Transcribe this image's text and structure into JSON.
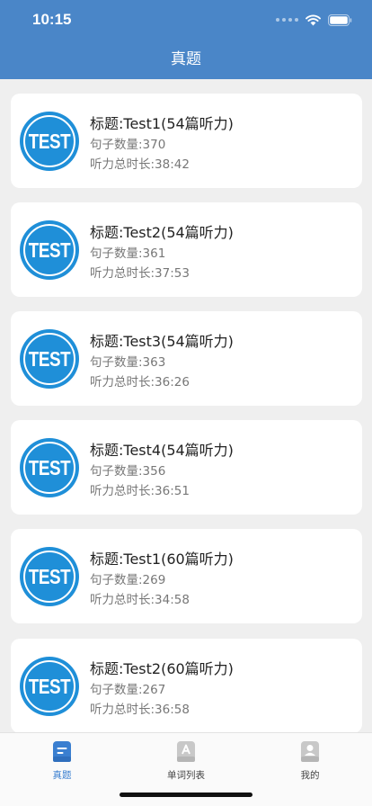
{
  "status": {
    "time": "10:15"
  },
  "nav": {
    "title": "真题"
  },
  "badge_text": "TEST",
  "cards": [
    {
      "title": "标题:Test1(54篇听力)",
      "sentences": "句子数量:370",
      "duration": "听力总时长:38:42"
    },
    {
      "title": "标题:Test2(54篇听力)",
      "sentences": "句子数量:361",
      "duration": "听力总时长:37:53"
    },
    {
      "title": "标题:Test3(54篇听力)",
      "sentences": "句子数量:363",
      "duration": "听力总时长:36:26"
    },
    {
      "title": "标题:Test4(54篇听力)",
      "sentences": "句子数量:356",
      "duration": "听力总时长:36:51"
    },
    {
      "title": "标题:Test1(60篇听力)",
      "sentences": "句子数量:269",
      "duration": "听力总时长:34:58"
    },
    {
      "title": "标题:Test2(60篇听力)",
      "sentences": "句子数量:267",
      "duration": "听力总时长:36:58"
    }
  ],
  "tabs": [
    {
      "label": "真题",
      "icon": "exam-icon",
      "active": true
    },
    {
      "label": "单词列表",
      "icon": "word-list-icon",
      "active": false
    },
    {
      "label": "我的",
      "icon": "profile-icon",
      "active": false
    }
  ],
  "colors": {
    "primary": "#4a86c8",
    "badge": "#1f8fd8",
    "tab_active": "#3a7fd0",
    "tab_inactive": "#c8c8c8"
  }
}
